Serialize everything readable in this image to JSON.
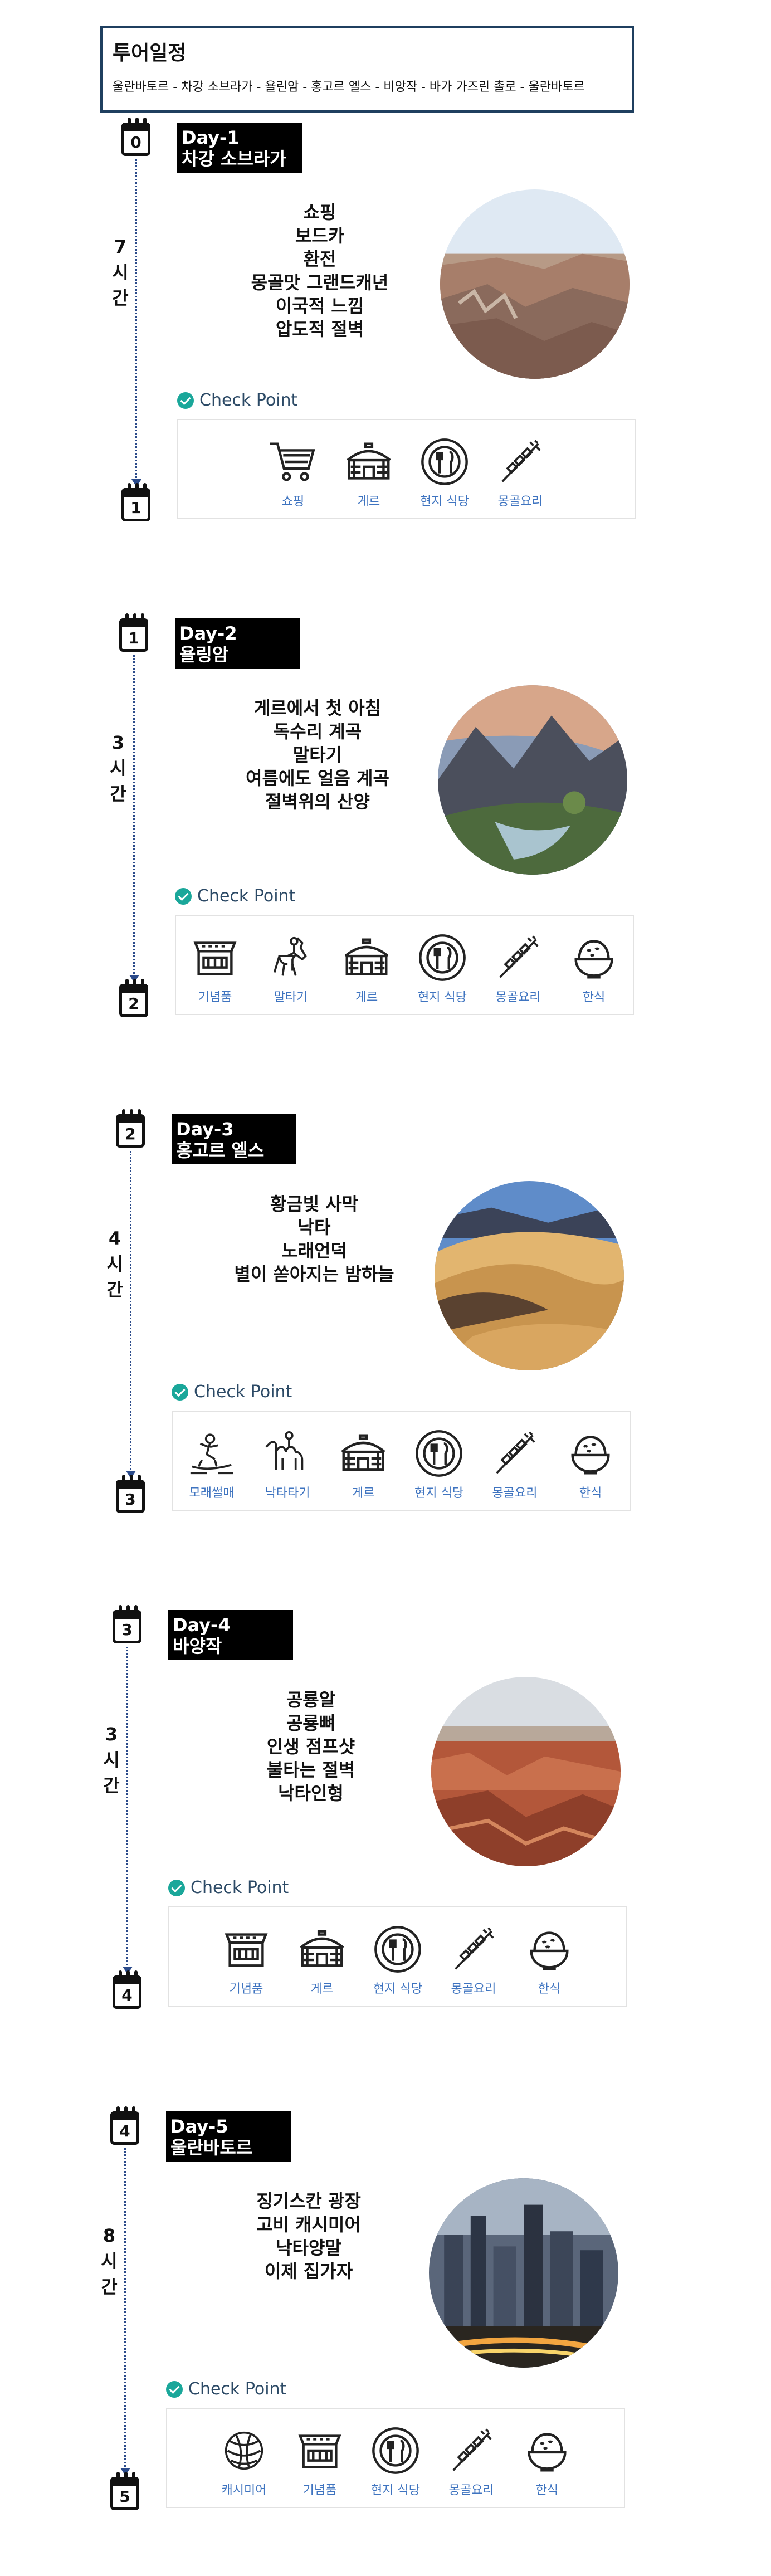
{
  "header": {
    "title": "투어일정",
    "route": "울란바토르 - 차강 소브라가 - 욜린암 - 홍고르 엘스 - 비앙작 - 바가 가즈린 촐로 - 울란바토르"
  },
  "check_point_label": "Check Point",
  "days": [
    {
      "day": "Day-1",
      "place": "차강 소브라가",
      "start_day": "0",
      "end_day": "1",
      "travel_hours": [
        "7",
        "시",
        "간"
      ],
      "highlights": [
        "쇼핑",
        "보드카",
        "환전",
        "몽골맛 그랜드캐년",
        "이국적 느낌",
        "압도적 절벽"
      ],
      "checkpoints": [
        {
          "icon": "cart-icon",
          "label": "쇼핑"
        },
        {
          "icon": "ger-icon",
          "label": "게르"
        },
        {
          "icon": "dining-icon",
          "label": "현지 식당"
        },
        {
          "icon": "skewer-icon",
          "label": "몽골요리"
        }
      ]
    },
    {
      "day": "Day-2",
      "place": "욜링암",
      "start_day": "1",
      "end_day": "2",
      "travel_hours": [
        "3",
        "시",
        "간"
      ],
      "highlights": [
        "게르에서 첫 아침",
        "독수리 계곡",
        "말타기",
        "여름에도 얼음 계곡",
        "절벽위의 산양"
      ],
      "checkpoints": [
        {
          "icon": "shop-icon",
          "label": "기념품"
        },
        {
          "icon": "horse-icon",
          "label": "말타기"
        },
        {
          "icon": "ger-icon",
          "label": "게르"
        },
        {
          "icon": "dining-icon",
          "label": "현지 식당"
        },
        {
          "icon": "skewer-icon",
          "label": "몽골요리"
        },
        {
          "icon": "rice-bowl-icon",
          "label": "한식"
        }
      ]
    },
    {
      "day": "Day-3",
      "place": "홍고르 엘스",
      "start_day": "2",
      "end_day": "3",
      "travel_hours": [
        "4",
        "시",
        "간"
      ],
      "highlights": [
        "황금빛 사막",
        "낙타",
        "노래언덕",
        "별이 쏟아지는 밤하늘"
      ],
      "checkpoints": [
        {
          "icon": "sandboard-icon",
          "label": "모래썰매"
        },
        {
          "icon": "camel-icon",
          "label": "낙타타기"
        },
        {
          "icon": "ger-icon",
          "label": "게르"
        },
        {
          "icon": "dining-icon",
          "label": "현지 식당"
        },
        {
          "icon": "skewer-icon",
          "label": "몽골요리"
        },
        {
          "icon": "rice-bowl-icon",
          "label": "한식"
        }
      ]
    },
    {
      "day": "Day-4",
      "place": "바양작",
      "start_day": "3",
      "end_day": "4",
      "travel_hours": [
        "3",
        "시",
        "간"
      ],
      "highlights": [
        "공룡알",
        "공룡뼈",
        "인생 점프샷",
        "불타는 절벽",
        "낙타인형"
      ],
      "checkpoints": [
        {
          "icon": "shop-icon",
          "label": "기념품"
        },
        {
          "icon": "ger-icon",
          "label": "게르"
        },
        {
          "icon": "dining-icon",
          "label": "현지 식당"
        },
        {
          "icon": "skewer-icon",
          "label": "몽골요리"
        },
        {
          "icon": "rice-bowl-icon",
          "label": "한식"
        }
      ]
    },
    {
      "day": "Day-5",
      "place": "울란바토르",
      "start_day": "4",
      "end_day": "5",
      "travel_hours": [
        "8",
        "시",
        "간"
      ],
      "highlights": [
        "징기스칸 광장",
        "고비 캐시미어",
        "낙타양말",
        "이제 집가자"
      ],
      "checkpoints": [
        {
          "icon": "yarn-icon",
          "label": "캐시미어"
        },
        {
          "icon": "shop-icon",
          "label": "기념품"
        },
        {
          "icon": "dining-icon",
          "label": "현지 식당"
        },
        {
          "icon": "skewer-icon",
          "label": "몽골요리"
        },
        {
          "icon": "rice-bowl-icon",
          "label": "한식"
        }
      ]
    }
  ]
}
